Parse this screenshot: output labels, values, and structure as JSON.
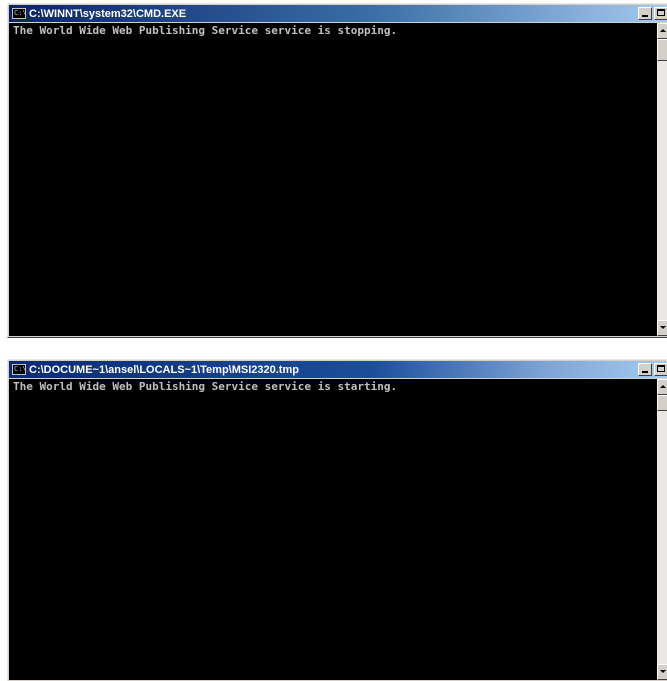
{
  "windows": [
    {
      "title": "C:\\WINNT\\system32\\CMD.EXE",
      "console_text": "The World Wide Web Publishing Service service is stopping."
    },
    {
      "title": "C:\\DOCUME~1\\ansel\\LOCALS~1\\Temp\\MSI2320.tmp",
      "console_text": "The World Wide Web Publishing Service service is starting."
    }
  ],
  "colors": {
    "console_bg": "#000000",
    "console_fg": "#c0c0c0",
    "titlebar_start": "#0a246a",
    "titlebar_end": "#a6caf0",
    "window_chrome": "#d4d0c8"
  },
  "icons": {
    "app_icon": "cmd-icon",
    "minimize": "minimize-icon",
    "maximize": "maximize-icon",
    "scroll_up": "arrow-up-icon",
    "scroll_down": "arrow-down-icon"
  }
}
